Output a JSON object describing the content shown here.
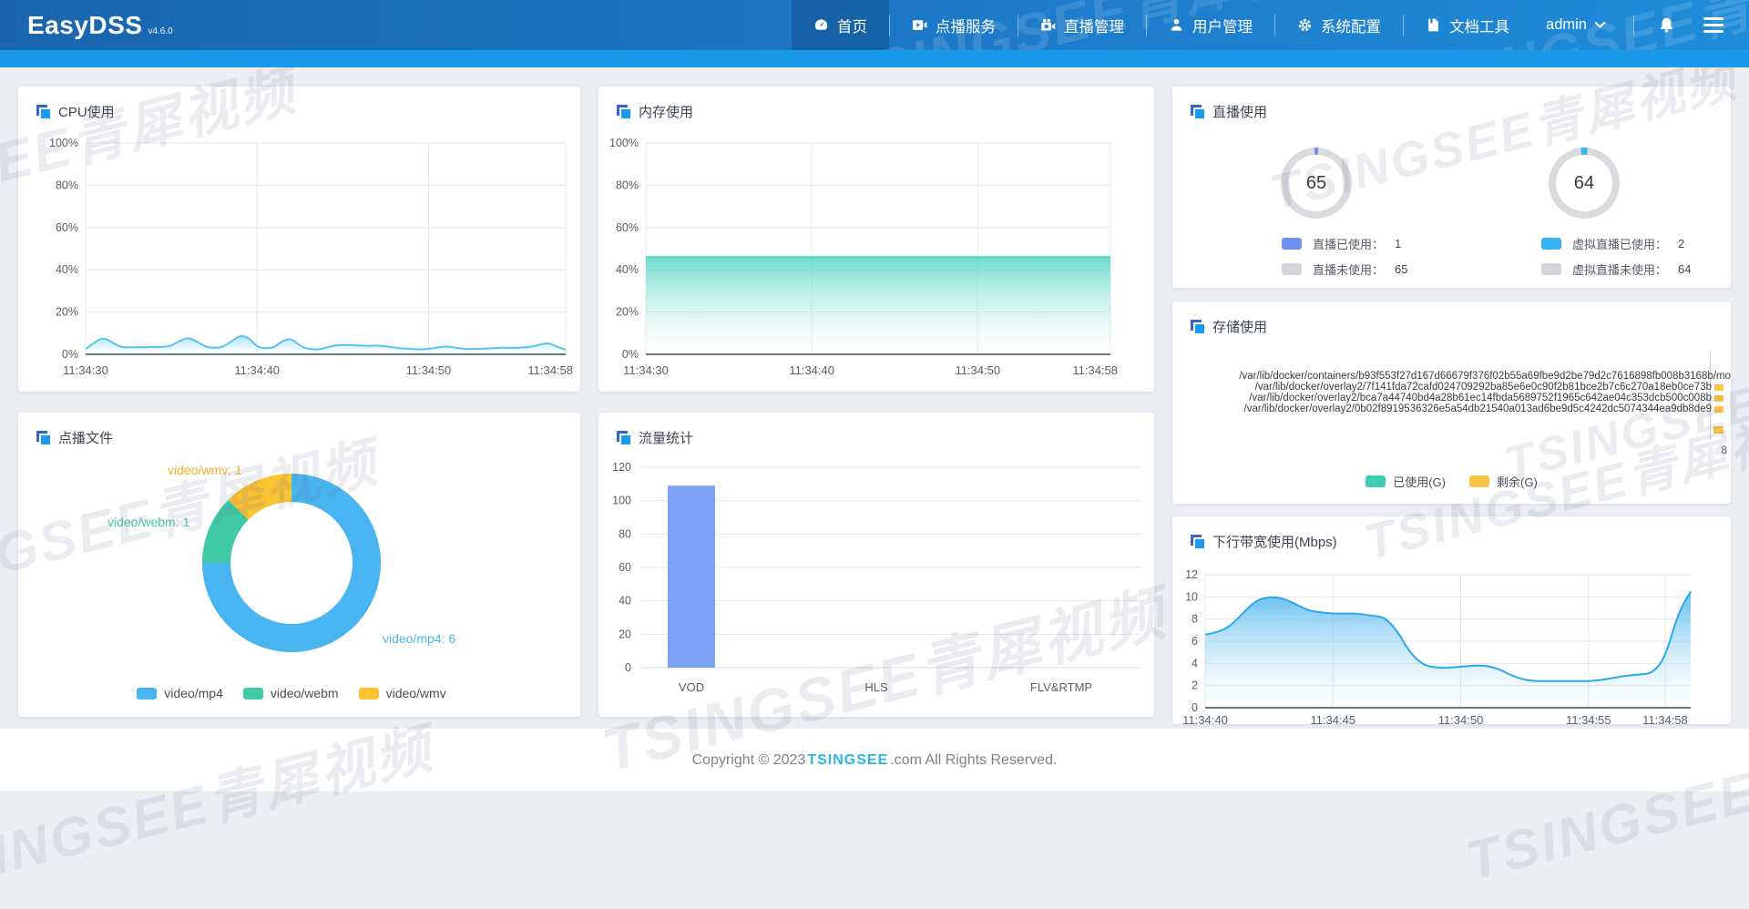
{
  "navbar": {
    "logo": "EasyDSS",
    "version": "v4.6.0",
    "items": [
      {
        "label": "首页",
        "active": true
      },
      {
        "label": "点播服务",
        "active": false
      },
      {
        "label": "直播管理",
        "active": false
      },
      {
        "label": "用户管理",
        "active": false
      },
      {
        "label": "系统配置",
        "active": false
      },
      {
        "label": "文档工具",
        "active": false
      }
    ],
    "user": "admin"
  },
  "watermark": {
    "text": "TSINGSEE青犀视频"
  },
  "panels": {
    "cpu": {
      "title": "CPU使用"
    },
    "memory": {
      "title": "内存使用"
    },
    "live": {
      "title": "直播使用",
      "gauges": [
        {
          "value": "65",
          "accent": "#6e8ff0",
          "track": "#d9dbde",
          "sweep_deg": 6,
          "legend": [
            {
              "label": "直播已使用：",
              "value": "1",
              "color": "#6e8ff0"
            },
            {
              "label": "直播未使用：",
              "value": "65",
              "color": "#d3d5d8"
            }
          ]
        },
        {
          "value": "64",
          "accent": "#38b3f2",
          "track": "#d9dbde",
          "sweep_deg": 11,
          "legend": [
            {
              "label": "虚拟直播已使用：",
              "value": "2",
              "color": "#38b3f2"
            },
            {
              "label": "虚拟直播未使用：",
              "value": "64",
              "color": "#d3d5d8"
            }
          ]
        }
      ]
    },
    "storage": {
      "title": "存储使用",
      "paths": [
        "/var/lib/docker/containers/b93f553f27d167d66679f376f02b55a69fbe9d2be79d2c7616898fb008b3168b/mo",
        "/var/lib/docker/overlay2/7f141fda72cafd024709292ba85e6e0c90f2b81bce2b7c6c270a18eb0ce73b",
        "/var/lib/docker/overlay2/bca7a44740bd4a28b61ec14fbda5689752f1965c642ae04c353dcb500c008b",
        "/var/lib/docker/overlay2/0b02f8919536326e5a54db21540a013ad6be9d5c4242dc5074344ea9db8de9"
      ],
      "partial_tick": "8",
      "legend": [
        {
          "label": "已使用(G)",
          "color": "#41cdb0"
        },
        {
          "label": "剩余(G)",
          "color": "#fbc348"
        }
      ]
    },
    "vod": {
      "title": "点播文件",
      "labels": [
        {
          "text": "video/wmv: 1",
          "color": "#f5b21f"
        },
        {
          "text": "video/webm: 1",
          "color": "#40c9a6"
        },
        {
          "text": "video/mp4: 6",
          "color": "#48b5f0"
        }
      ],
      "legend": [
        {
          "label": "video/mp4",
          "color": "#48b5f0"
        },
        {
          "label": "video/webm",
          "color": "#40c9a6"
        },
        {
          "label": "video/wmv",
          "color": "#fac332"
        }
      ]
    },
    "traffic": {
      "title": "流量统计"
    },
    "bandwidth": {
      "title": "下行带宽使用(Mbps)"
    }
  },
  "footer": {
    "prefix": "Copyright © 2023 ",
    "brand": "TSINGSEE",
    "suffix": ".com All Rights Reserved."
  },
  "chart_data": [
    {
      "id": "cpu",
      "type": "area",
      "title": "CPU使用",
      "x_unit": "time (hh:mm:ss)",
      "x_start": 30,
      "x_step": 0.5,
      "values": [
        2.5,
        5.5,
        8,
        6,
        3.5,
        3.2,
        3.4,
        3.3,
        3.6,
        3.4,
        4,
        6.5,
        8,
        6,
        3.5,
        3,
        3.5,
        6,
        9,
        8,
        3.5,
        2.8,
        3.2,
        6.5,
        7.5,
        4,
        2.5,
        2.2,
        3,
        4.2,
        4.5,
        4.3,
        4.2,
        4,
        4.2,
        3.8,
        3.2,
        2.8,
        2.5,
        2.3,
        2.5,
        3.2,
        3.8,
        3.2,
        2.6,
        2.5,
        2.6,
        2.8,
        3,
        3.2,
        3,
        3.2,
        3.6,
        4.5,
        5.5,
        3.5,
        2.2
      ],
      "x_ticks": [
        {
          "v": 30,
          "label": "11:34:30"
        },
        {
          "v": 40,
          "label": "11:34:40"
        },
        {
          "v": 50,
          "label": "11:34:50"
        },
        {
          "v": 58,
          "label": "11:34:58"
        }
      ],
      "y_ticks": [
        {
          "v": 0,
          "label": "0%"
        },
        {
          "v": 20,
          "label": "20%"
        },
        {
          "v": 40,
          "label": "40%"
        },
        {
          "v": 60,
          "label": "60%"
        },
        {
          "v": 80,
          "label": "80%"
        },
        {
          "v": 100,
          "label": "100%"
        }
      ],
      "ylim": [
        0,
        100
      ],
      "grid": true,
      "line_color": "#58c2ef",
      "fill_from": "rgba(120,205,245,0.6)",
      "fill_to": "rgba(180,228,250,0.03)"
    },
    {
      "id": "memory",
      "type": "area",
      "title": "内存使用",
      "x_unit": "time (hh:mm:ss)",
      "x_start": 30,
      "x_step": 28,
      "values": [
        46,
        46
      ],
      "x_ticks": [
        {
          "v": 30,
          "label": "11:34:30"
        },
        {
          "v": 40,
          "label": "11:34:40"
        },
        {
          "v": 50,
          "label": "11:34:50"
        },
        {
          "v": 58,
          "label": "11:34:58"
        }
      ],
      "y_ticks": [
        {
          "v": 0,
          "label": "0%"
        },
        {
          "v": 20,
          "label": "20%"
        },
        {
          "v": 40,
          "label": "40%"
        },
        {
          "v": 60,
          "label": "60%"
        },
        {
          "v": 80,
          "label": "80%"
        },
        {
          "v": 100,
          "label": "100%"
        }
      ],
      "ylim": [
        0,
        100
      ],
      "grid": true,
      "line_color": "#4fd6c2",
      "fill_from": "rgba(82,214,195,0.85)",
      "fill_to": "rgba(225,247,243,0.05)"
    },
    {
      "id": "live",
      "type": "pie",
      "title": "直播使用",
      "gauges": [
        {
          "center_value": 65,
          "segments": [
            {
              "name": "直播已使用",
              "value": 1
            },
            {
              "name": "直播未使用",
              "value": 65
            }
          ]
        },
        {
          "center_value": 64,
          "segments": [
            {
              "name": "虚拟直播已使用",
              "value": 2
            },
            {
              "name": "虚拟直播未使用",
              "value": 64
            }
          ]
        }
      ]
    },
    {
      "id": "vod",
      "type": "pie",
      "title": "点播文件",
      "categories": [
        "video/mp4",
        "video/webm",
        "video/wmv"
      ],
      "values": [
        6,
        1,
        1
      ],
      "colors": [
        "#48b5f0",
        "#40c9a6",
        "#fac332"
      ],
      "legend_position": "bottom"
    },
    {
      "id": "traffic",
      "type": "bar",
      "title": "流量统计",
      "categories": [
        "VOD",
        "HLS",
        "FLV&RTMP"
      ],
      "values": [
        109,
        0,
        0
      ],
      "ylim": [
        0,
        120
      ],
      "y_ticks": [
        {
          "v": 0,
          "label": "0"
        },
        {
          "v": 20,
          "label": "20"
        },
        {
          "v": 40,
          "label": "40"
        },
        {
          "v": 60,
          "label": "60"
        },
        {
          "v": 80,
          "label": "80"
        },
        {
          "v": 100,
          "label": "100"
        },
        {
          "v": 120,
          "label": "120"
        }
      ],
      "bar_color": "#7da1f4",
      "grid": true
    },
    {
      "id": "storage",
      "type": "bar-horizontal",
      "title": "存储使用",
      "categories": [
        "/var/lib/docker/containers/b93f553f27d167d66679f376f02b55a69fbe9d2be79d2c7616898fb008b3168b/mo",
        "/var/lib/docker/overlay2/7f141fda72cafd024709292ba85e6e0c90f2b81bce2b7c6c270a18eb0ce73b",
        "/var/lib/docker/overlay2/bca7a44740bd4a28b61ec14fbda5689752f1965c642ae04c353dcb500c008b",
        "/var/lib/docker/overlay2/0b02f8919536326e5a54db21540a013ad6be9d5c4242dc5074344ea9db8de9"
      ],
      "series": [
        {
          "name": "已使用(G)",
          "color": "#41cdb0"
        },
        {
          "name": "剩余(G)",
          "color": "#fbc348"
        }
      ],
      "note": "plot area clipped at panel edge; only small yellow 剩余 slivers and a partial x tick '8' are visible"
    },
    {
      "id": "bandwidth",
      "type": "area",
      "title": "下行带宽使用(Mbps)",
      "x_unit": "time (hh:mm:ss)",
      "x_start": 40,
      "x_step": 0.5,
      "values": [
        6.6,
        6.8,
        7.4,
        8.6,
        9.7,
        10,
        9.9,
        9.4,
        8.8,
        8.6,
        8.5,
        8.5,
        8.5,
        8.3,
        8.2,
        7,
        5,
        3.9,
        3.6,
        3.6,
        3.7,
        3.8,
        3.8,
        3.5,
        2.9,
        2.5,
        2.4,
        2.4,
        2.4,
        2.4,
        2.4,
        2.5,
        2.7,
        2.9,
        3,
        3.1,
        4.5,
        8.5,
        10.5
      ],
      "x_ticks": [
        {
          "v": 40,
          "label": "11:34:40"
        },
        {
          "v": 45,
          "label": "11:34:45"
        },
        {
          "v": 50,
          "label": "11:34:50"
        },
        {
          "v": 55,
          "label": "11:34:55"
        },
        {
          "v": 58,
          "label": "11:34:58"
        }
      ],
      "y_ticks": [
        {
          "v": 0,
          "label": "0"
        },
        {
          "v": 2,
          "label": "2"
        },
        {
          "v": 4,
          "label": "4"
        },
        {
          "v": 6,
          "label": "6"
        },
        {
          "v": 8,
          "label": "8"
        },
        {
          "v": 10,
          "label": "10"
        },
        {
          "v": 12,
          "label": "12"
        }
      ],
      "ylim": [
        0,
        12
      ],
      "grid": true,
      "line_color": "#2ba8e8",
      "fill_from": "rgba(70,178,235,0.85)",
      "fill_to": "rgba(214,238,250,0.06)"
    }
  ]
}
